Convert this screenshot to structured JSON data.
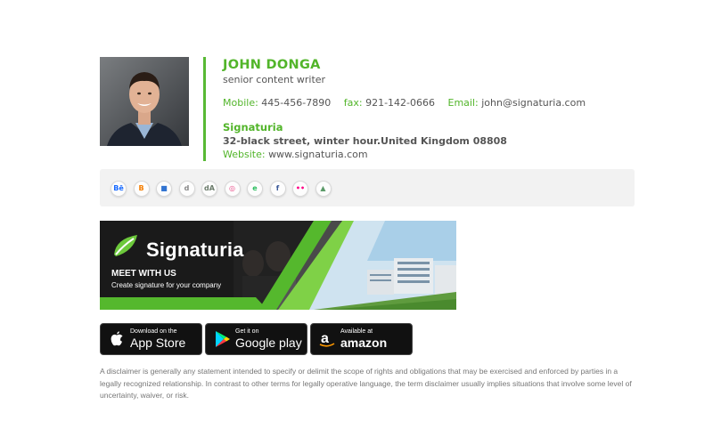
{
  "profile": {
    "name": "JOHN DONGA",
    "title": "senior content writer",
    "mobile_label": "Mobile:",
    "mobile": "445-456-7890",
    "fax_label": "fax:",
    "fax": "921-142-0666",
    "email_label": "Email:",
    "email": "john@signaturia.com",
    "company": "Signaturia",
    "address": "32-black street, winter hour.United Kingdom 08808",
    "website_label": "Website:",
    "website": "www.signaturia.com"
  },
  "social_icons": [
    {
      "name": "behance-icon",
      "glyph": "Bē",
      "color": "#1769ff"
    },
    {
      "name": "blogger-icon",
      "glyph": "B",
      "color": "#f57d00"
    },
    {
      "name": "delicious-icon",
      "glyph": "■",
      "color": "#3274d1"
    },
    {
      "name": "digg-icon",
      "glyph": "d",
      "color": "#888888"
    },
    {
      "name": "deviantart-icon",
      "glyph": "dA",
      "color": "#6b7b6b"
    },
    {
      "name": "dribbble-icon",
      "glyph": "◎",
      "color": "#ea4c89"
    },
    {
      "name": "evernote-icon",
      "glyph": "e",
      "color": "#2dbe60"
    },
    {
      "name": "facebook-icon",
      "glyph": "f",
      "color": "#3b5998"
    },
    {
      "name": "flickr-icon",
      "glyph": "••",
      "color": "#ff0084"
    },
    {
      "name": "forrst-icon",
      "glyph": "▲",
      "color": "#5b9a68"
    }
  ],
  "banner": {
    "brand": "Signaturia",
    "headline": "MEET WITH US",
    "tagline": "Create signature for your company"
  },
  "stores": [
    {
      "small": "Download on the",
      "big": "App Store"
    },
    {
      "small": "Get it on",
      "big": "Google play"
    },
    {
      "small": "Available at",
      "big": "amazon"
    }
  ],
  "disclaimer": "A disclaimer is generally any statement intended to specify or delimit the scope of rights and obligations that may be exercised and enforced by parties in a legally recognized relationship. In contrast to other terms for legally operative language, the term disclaimer usually implies situations that involve some level of uncertainty, waiver, or risk.",
  "colors": {
    "accent": "#52b52a",
    "text": "#555555"
  }
}
